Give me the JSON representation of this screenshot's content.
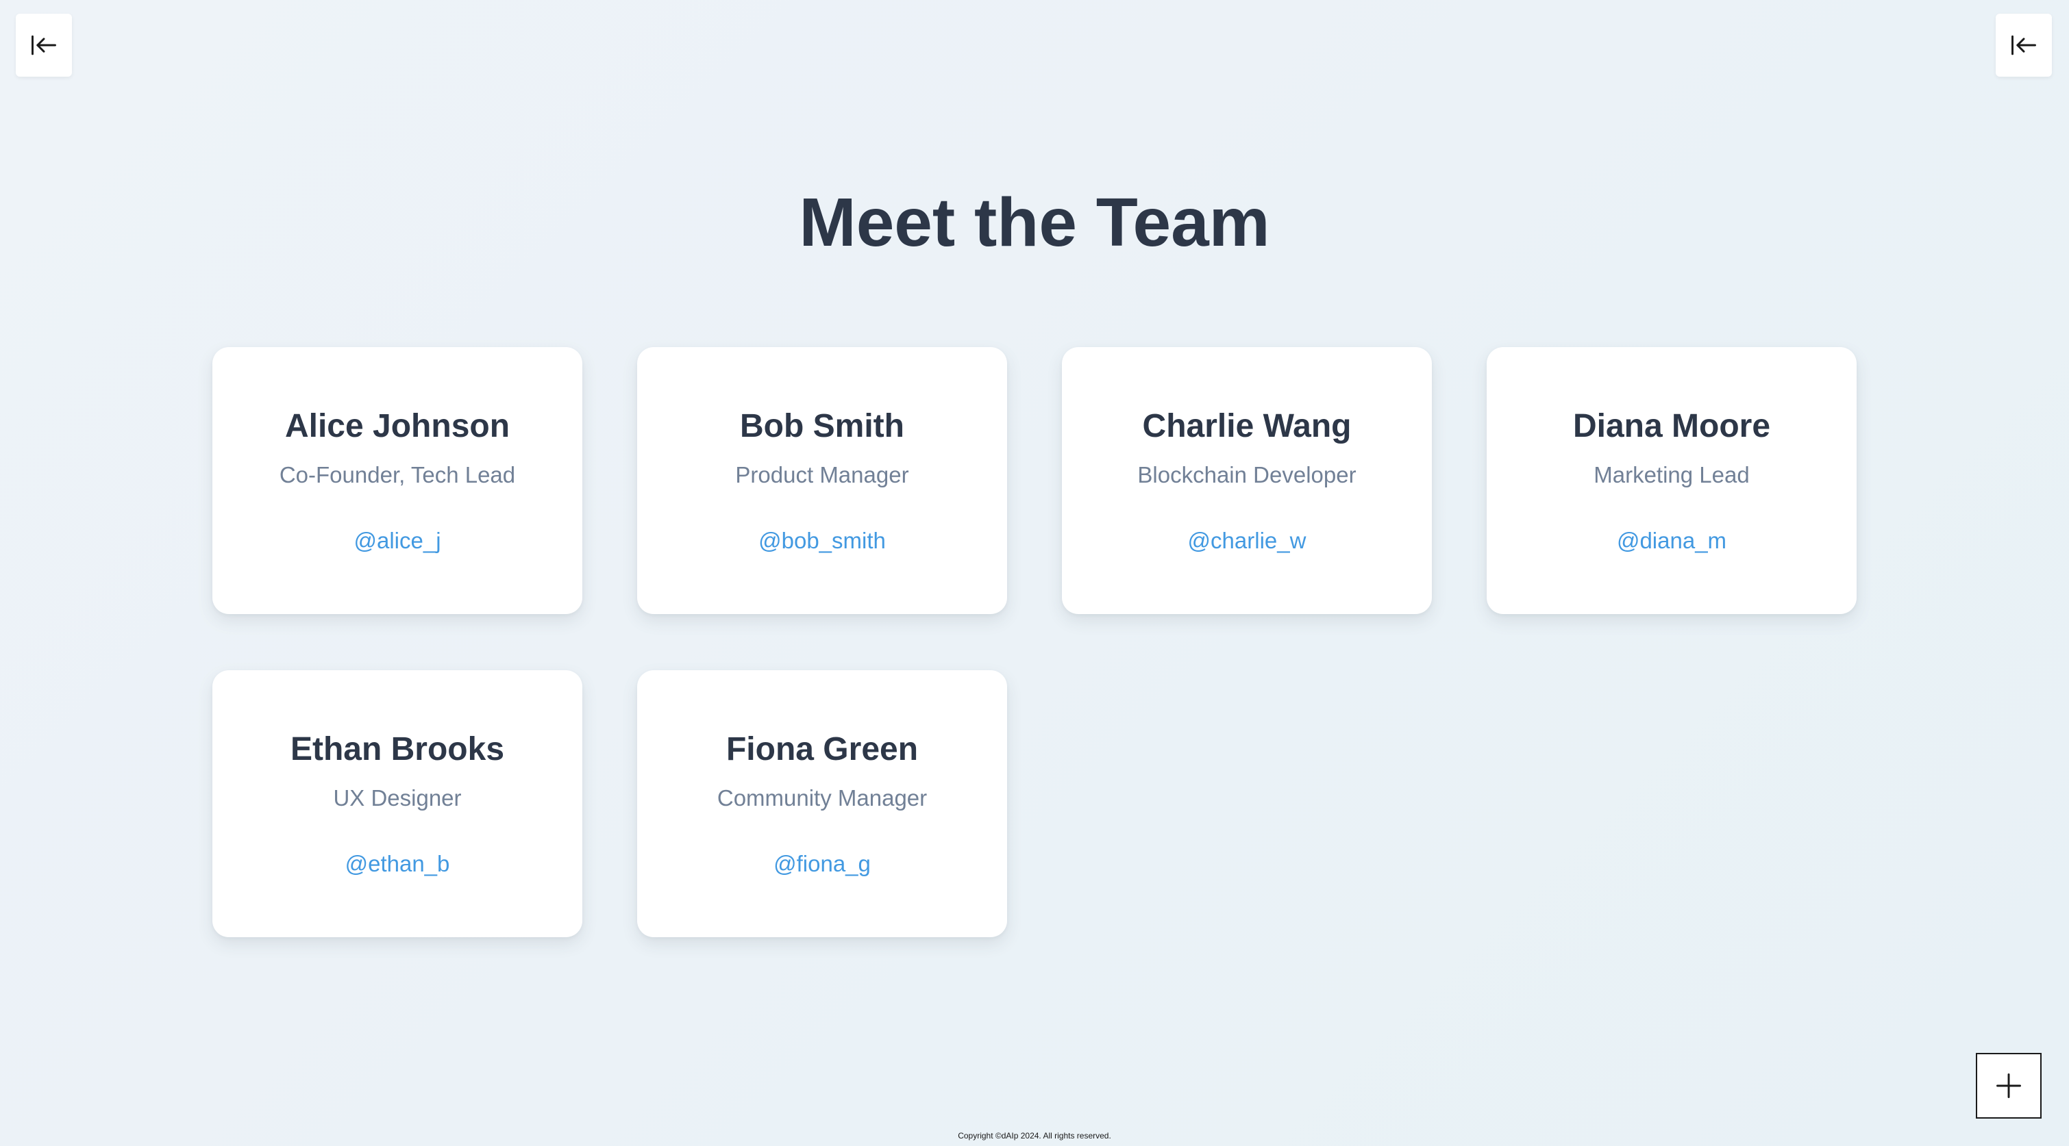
{
  "page": {
    "title": "Meet the Team"
  },
  "team": [
    {
      "name": "Alice Johnson",
      "role": "Co-Founder, Tech Lead",
      "handle": "@alice_j"
    },
    {
      "name": "Bob Smith",
      "role": "Product Manager",
      "handle": "@bob_smith"
    },
    {
      "name": "Charlie Wang",
      "role": "Blockchain Developer",
      "handle": "@charlie_w"
    },
    {
      "name": "Diana Moore",
      "role": "Marketing Lead",
      "handle": "@diana_m"
    },
    {
      "name": "Ethan Brooks",
      "role": "UX Designer",
      "handle": "@ethan_b"
    },
    {
      "name": "Fiona Green",
      "role": "Community Manager",
      "handle": "@fiona_g"
    }
  ],
  "footer": {
    "copyright": "Copyright ©dAIp 2024. All rights reserved."
  },
  "icons": {
    "left_panel": "collapse-left-icon",
    "right_panel": "collapse-left-icon",
    "add": "plus-icon"
  },
  "colors": {
    "heading": "#2d3748",
    "role": "#718096",
    "handle": "#4299e1",
    "background": "#eaf2f7"
  }
}
